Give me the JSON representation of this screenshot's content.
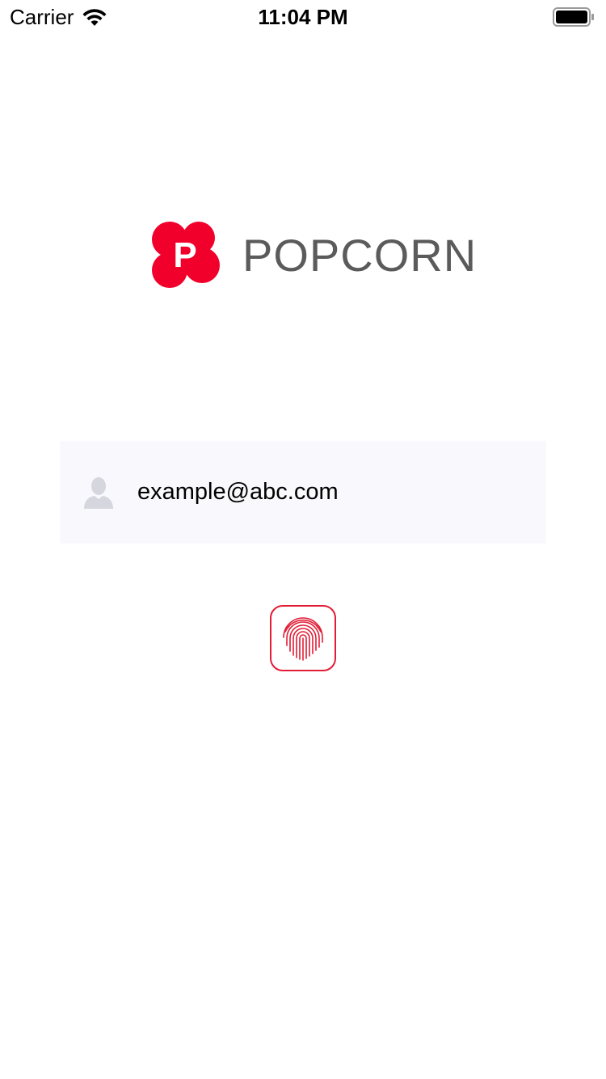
{
  "status_bar": {
    "carrier": "Carrier",
    "time": "11:04 PM",
    "icons": [
      "wifi-icon",
      "battery-icon"
    ]
  },
  "brand": {
    "logo_letter": "P",
    "name": "POPCORN",
    "accent_color": "#f0002a",
    "text_color": "#5b5b5b"
  },
  "login": {
    "email_value": "example@abc.com",
    "field_icon": "user-icon",
    "field_background": "#f9f9fd"
  },
  "touch_id": {
    "icon": "fingerprint-icon",
    "accent_color": "#e11d36"
  }
}
